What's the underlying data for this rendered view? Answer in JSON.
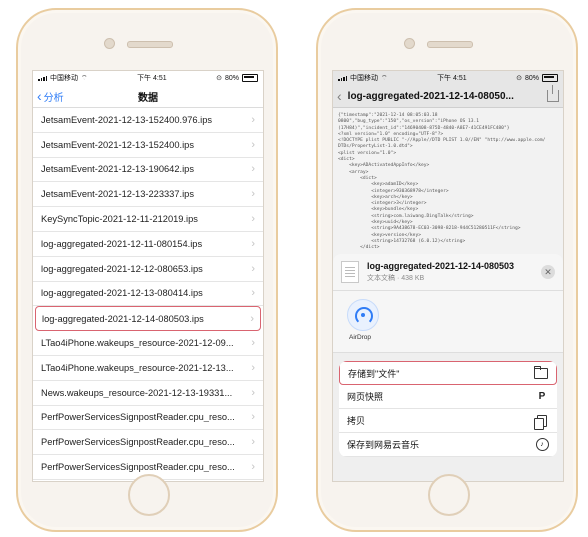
{
  "left": {
    "status": {
      "carrier": "中国移动",
      "time": "下午 4:51",
      "battery": "80%"
    },
    "nav": {
      "back_label": "分析",
      "title": "数据"
    },
    "files": [
      "JetsamEvent-2021-12-13-152400.976.ips",
      "JetsamEvent-2021-12-13-152400.ips",
      "JetsamEvent-2021-12-13-190642.ips",
      "JetsamEvent-2021-12-13-223337.ips",
      "KeySyncTopic-2021-12-11-212019.ips",
      "log-aggregated-2021-12-11-080154.ips",
      "log-aggregated-2021-12-12-080653.ips",
      "log-aggregated-2021-12-13-080414.ips",
      "log-aggregated-2021-12-14-080503.ips",
      "LTao4iPhone.wakeups_resource-2021-12-09...",
      "LTao4iPhone.wakeups_resource-2021-12-13...",
      "News.wakeups_resource-2021-12-13-19331...",
      "PerfPowerServicesSignpostReader.cpu_reso...",
      "PerfPowerServicesSignpostReader.cpu_reso...",
      "PerfPowerServicesSignpostReader.cpu_reso..."
    ],
    "selected_index": 8
  },
  "right": {
    "status": {
      "carrier": "中国移动",
      "time": "下午 4:51",
      "battery": "80%"
    },
    "nav": {
      "title": "log-aggregated-2021-12-14-08050..."
    },
    "code_lines": [
      "{\"timestamp\":\"2021-12-14 08:05:03.18",
      "0800\",\"bug_type\":\"150\",\"os_version\":\"iPhone OS 13.1",
      "(17H84)\",\"incident_id\":\"14690408-875D-4840-A8E7-41CE491FC480\"}",
      "<?xml version=\"1.0\" encoding=\"UTF-8\"?>",
      "<!DOCTYPE plist PUBLIC \"-//Apple//DTD PLIST 1.0//EN\" \"http://www.apple.com/",
      "DTDs/PropertyList-1.0.dtd\">",
      "<plist version=\"1.0\">",
      "<dict>",
      "    <key>ADActivatedAppInfo</key>",
      "    <array>",
      "        <dict>",
      "            <key>adamID</key>",
      "            <integer>930368978</integer>",
      "            <key>arch</key>",
      "            <integer>3</integer>",
      "            <key>bundle</key>",
      "            <string>com.laiwang.DingTalk</string>",
      "            <key>uuid</key>",
      "            <string>9A438678-EC03-3098-8218-944C51280511F</string>",
      "            <key>version</key>",
      "            <string>14732768 (6.0.12)</string>",
      "        </dict>"
    ],
    "sheet": {
      "file_name": "log-aggregated-2021-12-14-080503",
      "file_meta": "文本文稿 · 438 KB",
      "airdrop_label": "AirDrop",
      "actions": [
        {
          "label": "存储到\"文件\"",
          "icon": "folder-icon"
        },
        {
          "label": "网页快照",
          "icon": "p-icon"
        },
        {
          "label": "拷贝",
          "icon": "copy-icon"
        },
        {
          "label": "保存到网易云音乐",
          "icon": "music-icon"
        }
      ]
    }
  }
}
